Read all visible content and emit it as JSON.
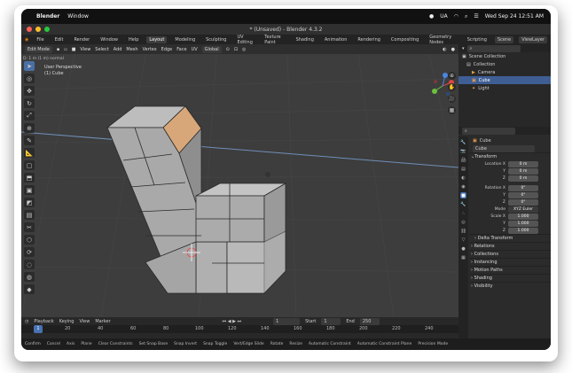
{
  "mac_menubar": {
    "app": "Blender",
    "menu": "Window",
    "status_extra": "UA",
    "datetime": "Wed Sep 24  12:51 AM"
  },
  "window": {
    "title": "* (Unsaved) - Blender 4.3.2"
  },
  "topbar": {
    "menus": [
      "File",
      "Edit",
      "Render",
      "Window",
      "Help"
    ],
    "workspaces": [
      "Layout",
      "Modeling",
      "Sculpting",
      "UV Editing",
      "Texture Paint",
      "Shading",
      "Animation",
      "Rendering",
      "Compositing",
      "Geometry Nodes",
      "Scripting"
    ],
    "active_workspace": "Layout",
    "scene": "Scene",
    "view_layer": "ViewLayer"
  },
  "viewport_header": {
    "mode": "Edit Mode",
    "menus": [
      "View",
      "Select",
      "Add",
      "Mesh",
      "Vertex",
      "Edge",
      "Face",
      "UV"
    ],
    "orientation": "Global",
    "hint": "D: 1 m (1 m) normal"
  },
  "viewport": {
    "perspective": "User Perspective",
    "object": "(1) Cube",
    "gizmo_axes": [
      "X",
      "Y",
      "Z"
    ]
  },
  "toolbar_icons": [
    "select-icon",
    "cursor-icon",
    "move-icon",
    "rotate-icon",
    "scale-icon",
    "transform-icon",
    "annotate-icon",
    "measure-icon",
    "add-cube-icon",
    "extrude-icon",
    "inset-icon",
    "bevel-icon",
    "loopcut-icon",
    "knife-icon",
    "polybuild-icon",
    "spin-icon",
    "smooth-icon",
    "edge-slide-icon",
    "shrink-icon",
    "shear-icon",
    "rip-icon"
  ],
  "outliner": {
    "title": "Scene Collection",
    "items": [
      {
        "label": "Collection",
        "depth": 1
      },
      {
        "label": "Camera",
        "depth": 2
      },
      {
        "label": "Cube",
        "depth": 2,
        "selected": true
      },
      {
        "label": "Light",
        "depth": 2
      }
    ]
  },
  "properties": {
    "object_name": "Cube",
    "mesh_name": "Cube",
    "transform_label": "Transform",
    "location": {
      "label": "Location X",
      "x": "0 m",
      "y": "0 m",
      "z": "0 m"
    },
    "rotation": {
      "label": "Rotation X",
      "x": "0°",
      "y": "0°",
      "z": "0°"
    },
    "mode_label": "Mode",
    "mode": "XYZ Euler",
    "scale": {
      "label": "Scale X",
      "x": "1.000",
      "y": "1.000",
      "z": "1.000"
    },
    "sections": [
      "Delta Transform",
      "Relations",
      "Collections",
      "Instancing",
      "Motion Paths",
      "Shading",
      "Visibility"
    ]
  },
  "timeline": {
    "menus": [
      "Playback",
      "Keying",
      "View",
      "Marker"
    ],
    "current_frame": "1",
    "start_label": "Start",
    "start": "1",
    "end_label": "End",
    "end": "250",
    "ruler": [
      "1",
      "20",
      "40",
      "60",
      "80",
      "100",
      "120",
      "140",
      "160",
      "180",
      "200",
      "220",
      "240"
    ]
  },
  "statusbar": {
    "items": [
      "Confirm",
      "Cancel",
      "Axis",
      "Plane",
      "Clear Constraints",
      "Set Snap Base",
      "Snap Invert",
      "Snap Toggle",
      "Vert/Edge Slide",
      "Rotate",
      "Resize",
      "Automatic Constraint",
      "Automatic Constraint Plane",
      "Precision Mode"
    ]
  },
  "colors": {
    "accent": "#4772b3",
    "viewport_bg": "#3d3d3d",
    "selection": "#f3a24b"
  }
}
